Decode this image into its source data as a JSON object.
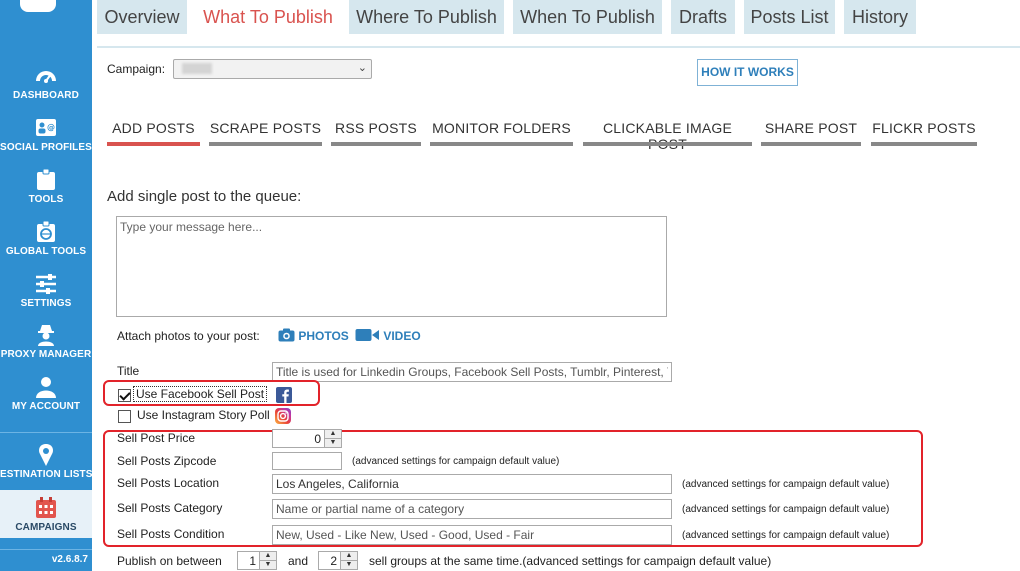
{
  "sidebar": {
    "items": [
      {
        "label": "DASHBOARD",
        "icon": "dashboard-icon"
      },
      {
        "label": "SOCIAL PROFILES",
        "icon": "social-profiles-icon"
      },
      {
        "label": "TOOLS",
        "icon": "tools-icon"
      },
      {
        "label": "GLOBAL TOOLS",
        "icon": "global-tools-icon"
      },
      {
        "label": "SETTINGS",
        "icon": "settings-icon"
      },
      {
        "label": "PROXY MANAGER",
        "icon": "proxy-manager-icon"
      },
      {
        "label": "MY ACCOUNT",
        "icon": "account-icon"
      },
      {
        "label": "ESTINATION LISTS",
        "icon": "destination-lists-icon"
      },
      {
        "label": "CAMPAIGNS",
        "icon": "campaigns-icon"
      }
    ],
    "version": "v2.6.8.7"
  },
  "top_tabs": [
    "Overview",
    "What To Publish",
    "Where To Publish",
    "When To Publish",
    "Drafts",
    "Posts List",
    "History"
  ],
  "active_top_tab": "What To Publish",
  "campaign": {
    "label": "Campaign:"
  },
  "how_it_works": "HOW IT WORKS",
  "sub_tabs": [
    "ADD POSTS",
    "SCRAPE POSTS",
    "RSS POSTS",
    "MONITOR FOLDERS",
    "CLICKABLE IMAGE POST",
    "SHARE POST",
    "FLICKR POSTS"
  ],
  "active_sub_tab": "ADD POSTS",
  "section_title": "Add single post to the queue:",
  "message_placeholder": "Type your message here...",
  "attach": {
    "label": "Attach photos to your post:",
    "photos": "PHOTOS",
    "video": "VIDEO"
  },
  "title_row": {
    "label": "Title",
    "placeholder": "Title is used for Linkedin Groups, Facebook Sell Posts, Tumblr, Pinterest, Yo"
  },
  "facebook_sell": {
    "label": "Use Facebook Sell Post",
    "checked": true
  },
  "instagram_story": {
    "label": "Use Instagram Story Poll",
    "checked": false
  },
  "sell": {
    "price": {
      "label": "Sell Post Price",
      "value": "0"
    },
    "zipcode": {
      "label": "Sell Posts Zipcode",
      "hint": "(advanced settings for campaign default value)"
    },
    "location": {
      "label": "Sell Posts Location",
      "value": "Los Angeles, California",
      "hint": "(advanced settings for campaign default value)"
    },
    "category": {
      "label": "Sell Posts Category",
      "placeholder": "Name or partial name of a category",
      "hint": "(advanced settings for campaign default value)"
    },
    "condition": {
      "label": "Sell Posts Condition",
      "placeholder": "New, Used - Like New, Used - Good, Used - Fair",
      "hint": "(advanced settings for campaign default value)"
    }
  },
  "publish": {
    "label": "Publish on between",
    "from": "1",
    "and": "and",
    "to": "2",
    "suffix": "sell groups at the same time.(advanced settings for campaign default value)"
  },
  "colors": {
    "sidebar": "#2f8fd0",
    "accent_red": "#d9534f",
    "link_blue": "#2e7fba",
    "highlight_red": "#e2232a"
  }
}
